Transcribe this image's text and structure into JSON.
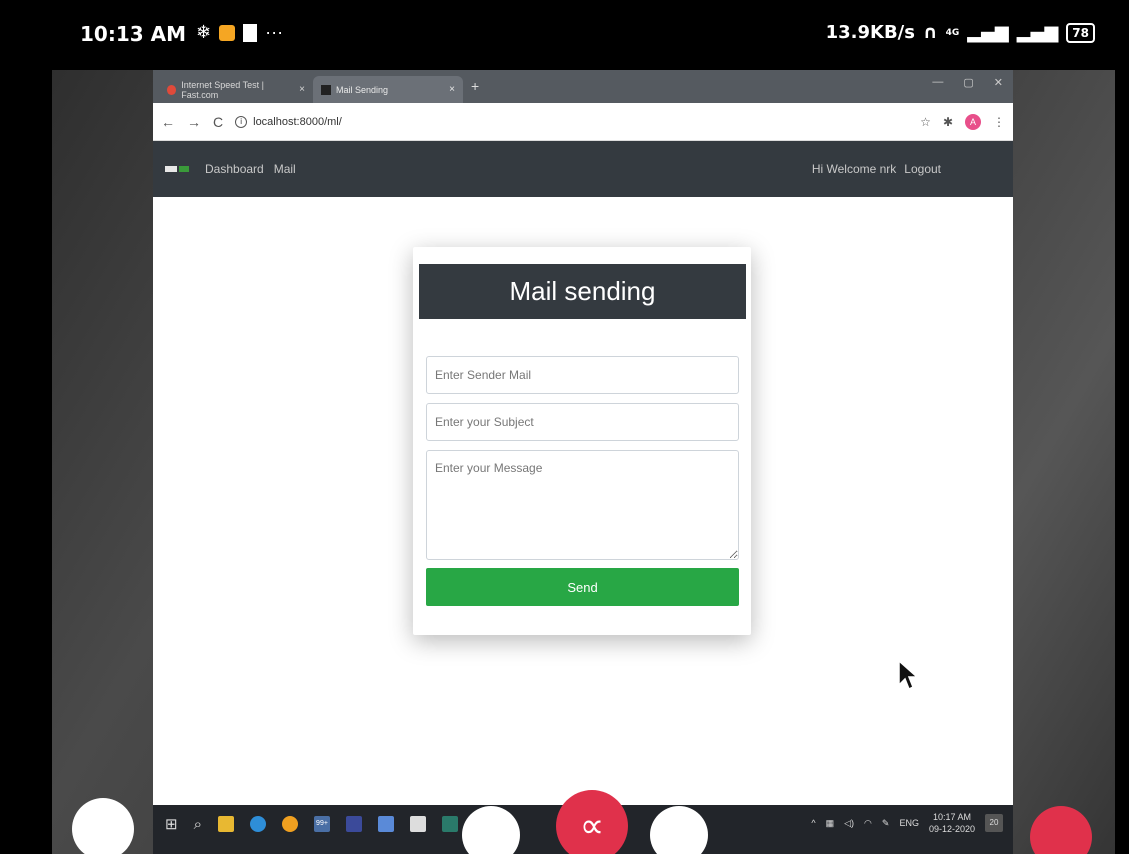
{
  "status_bar": {
    "time": "10:13 AM",
    "speed": "13.9KB/s",
    "network": "4G",
    "battery": "78"
  },
  "browser": {
    "tabs": [
      {
        "label": "Internet Speed Test | Fast.com",
        "icon": "fast-icon",
        "close": "×"
      },
      {
        "label": "Mail Sending",
        "icon": "page-icon",
        "close": "×"
      }
    ],
    "new_tab": "+",
    "url": "localhost:8000/ml/",
    "profile_initial": "A"
  },
  "site_nav": {
    "links": [
      "Dashboard",
      "Mail"
    ],
    "welcome": "Hi Welcome nrk",
    "logout": "Logout"
  },
  "form": {
    "title": "Mail sending",
    "sender_placeholder": "Enter Sender Mail",
    "subject_placeholder": "Enter your Subject",
    "message_placeholder": "Enter your Message",
    "send_label": "Send"
  },
  "taskbar": {
    "lang": "ENG",
    "time": "10:17 AM",
    "date": "09-12-2020",
    "notifications": "20",
    "badge": "99+"
  },
  "colors": {
    "navbar": "#343a40",
    "send": "#28a745",
    "record": "#e0314b"
  }
}
